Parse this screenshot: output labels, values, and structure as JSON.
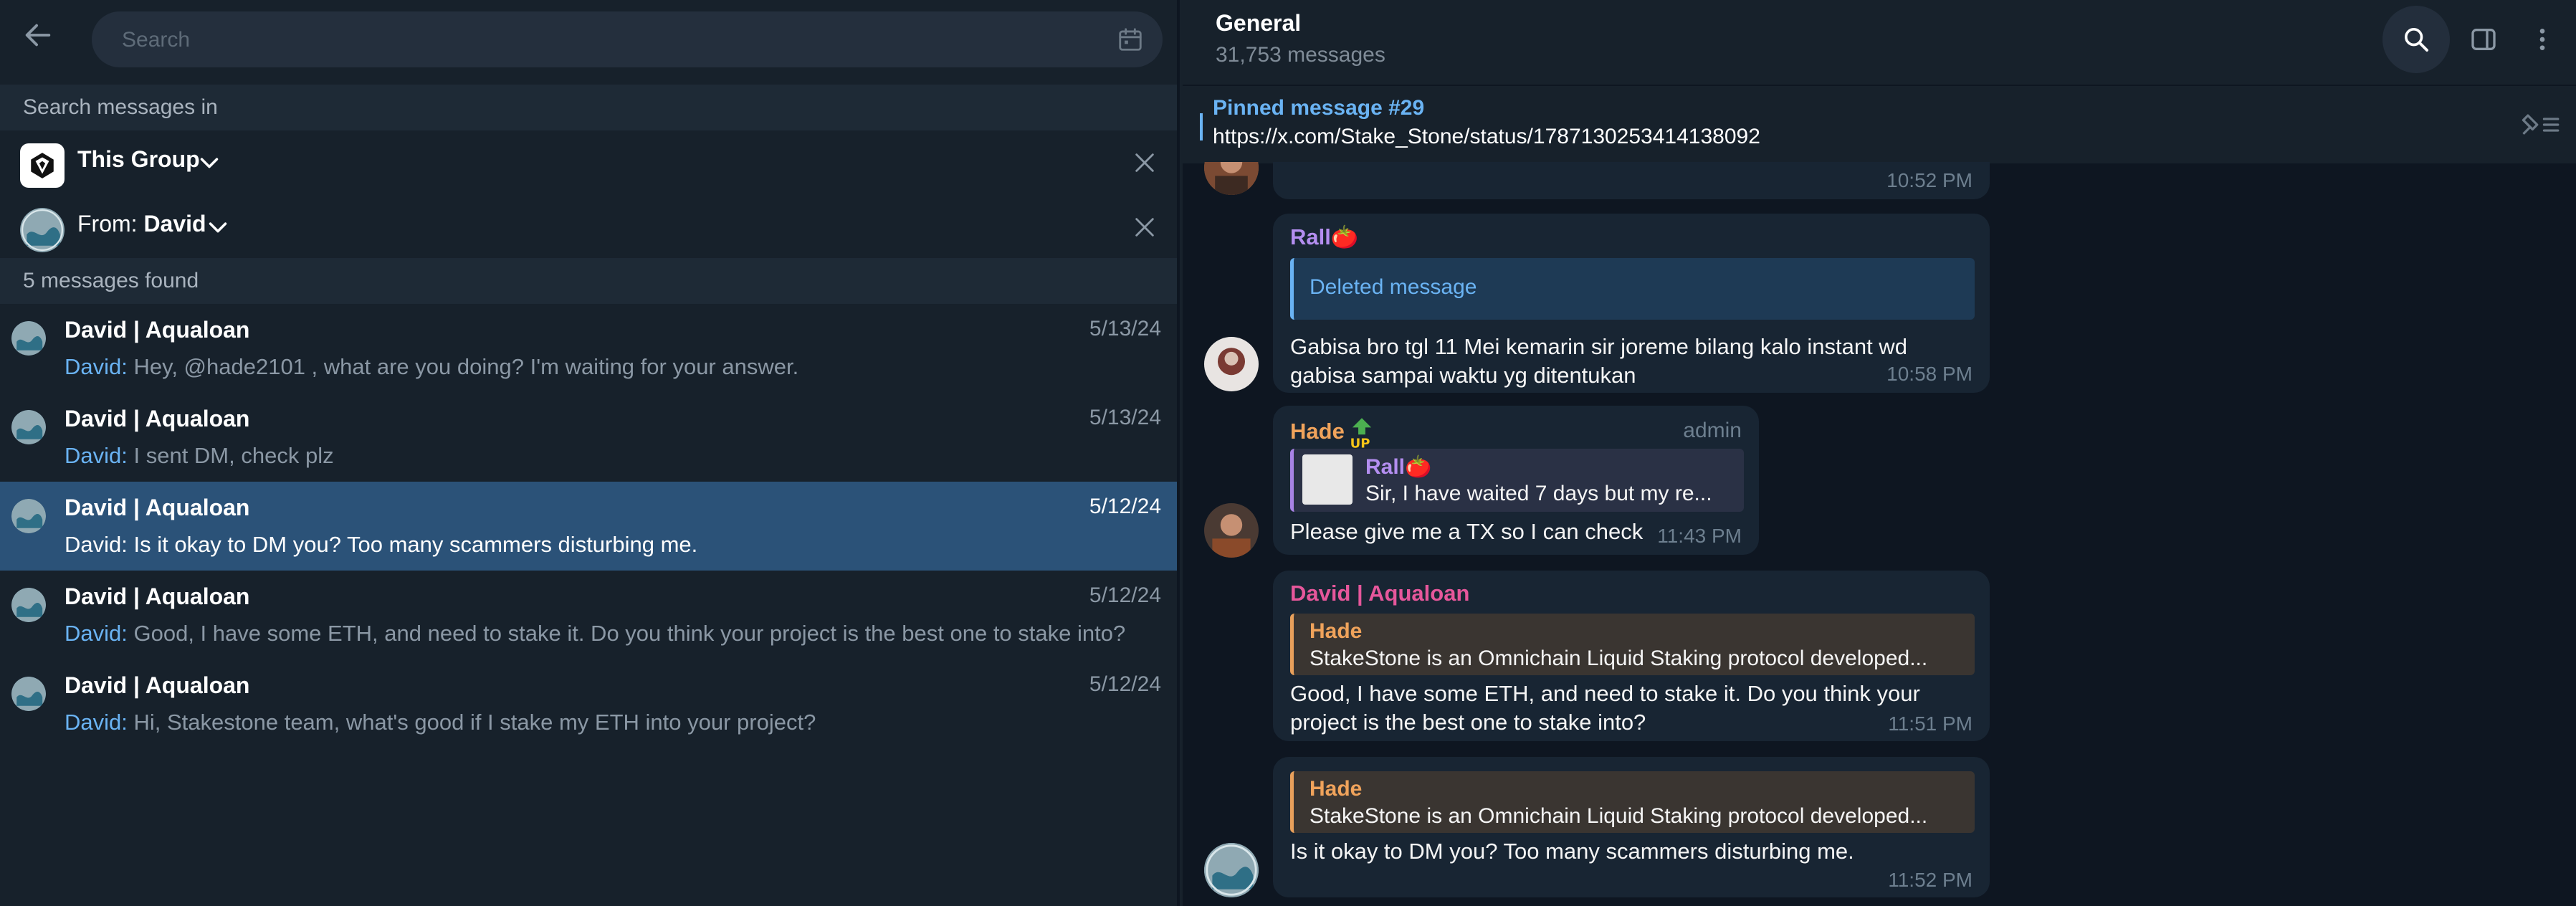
{
  "search": {
    "placeholder": "Search"
  },
  "search_in": {
    "label": "Search messages in",
    "group_label": "This Group",
    "from_prefix": "From:",
    "from_name": "David"
  },
  "results": {
    "count_label": "5 messages found",
    "items": [
      {
        "name": "David | Aqualoan",
        "date": "5/13/24",
        "who": "David:",
        "text": " Hey, @hade2101 , what are you doing? I'm waiting for your answer."
      },
      {
        "name": "David | Aqualoan",
        "date": "5/13/24",
        "who": "David:",
        "text": " I sent DM, check plz"
      },
      {
        "name": "David | Aqualoan",
        "date": "5/12/24",
        "who": "David:",
        "text": " Is it okay to DM you? Too many scammers disturbing me."
      },
      {
        "name": "David | Aqualoan",
        "date": "5/12/24",
        "who": "David:",
        "text": " Good, I have some ETH, and need to stake it. Do you think your project is the best one to stake into?"
      },
      {
        "name": "David | Aqualoan",
        "date": "5/12/24",
        "who": "David:",
        "text": " Hi, Stakestone team, what's good if I stake my ETH into your project?"
      }
    ],
    "selected_index": 2
  },
  "chat": {
    "title": "General",
    "subtitle": "31,753 messages",
    "pinned_title": "Pinned message #29",
    "pinned_text": "https://x.com/Stake_Stone/status/1787130253414138092"
  },
  "messages": {
    "m0": {
      "time": "10:52 PM"
    },
    "m1": {
      "sender": "Rall🍅",
      "reply_text": "Deleted message",
      "line1": "Gabisa bro tgl 11 Mei kemarin sir joreme bilang kalo instant wd",
      "line2": "gabisa sampai waktu yg ditentukan",
      "time": "10:58 PM"
    },
    "m2": {
      "sender": "Hade",
      "badge": "admin",
      "reply_name": "Rall🍅",
      "reply_text": "Sir, I have waited 7 days but my re...",
      "text": "Please give me a TX so I can check",
      "time": "11:43 PM"
    },
    "m3": {
      "sender": "David | Aqualoan",
      "reply_name": "Hade",
      "reply_text": "StakeStone is an Omnichain Liquid Staking protocol developed...",
      "line1": "Good, I have some ETH, and need to stake it. Do you think your",
      "line2": "project is the best one to stake into?",
      "time": "11:51 PM"
    },
    "m4": {
      "reply_name": "Hade",
      "reply_text": "StakeStone is an Omnichain Liquid Staking protocol developed...",
      "text": "Is it okay to DM you? Too many scammers disturbing me.",
      "time": "11:52 PM"
    }
  },
  "colors": {
    "accent": "#6ab3f3",
    "selected_row": "#2b5278",
    "sender_rall": "#b48ef0",
    "sender_hade": "#f0a35b",
    "sender_david": "#e6579b"
  }
}
